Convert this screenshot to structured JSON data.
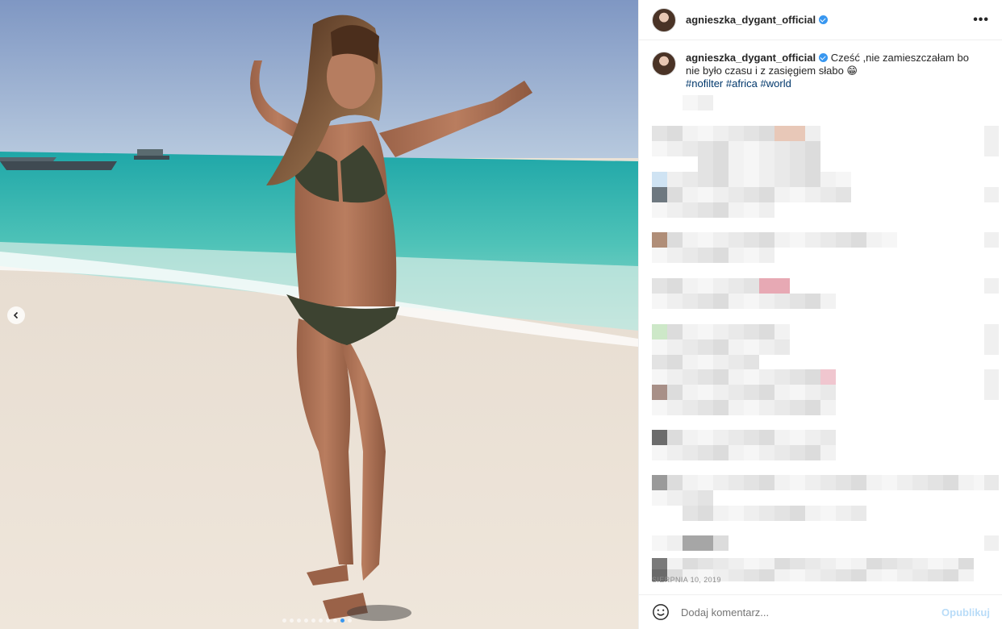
{
  "post": {
    "username": "agnieszka_dygant_official",
    "caption_text": "Cześć ,nie zamieszczałam bo nie było czasu i z zasięgiem słabo 😁",
    "hashtags": [
      "#nofilter",
      "#africa",
      "#world"
    ],
    "date": "SIERPNIA 10, 2019"
  },
  "header": {
    "more_label": "•••"
  },
  "comment_box": {
    "placeholder": "Dodaj komentarz...",
    "publish_label": "Opublikuj"
  },
  "colors": {
    "accent": "#3897f0",
    "text": "#262626",
    "muted": "#8e8e8e",
    "hashtag": "#00376b",
    "publish_disabled": "#b9dcf8"
  },
  "icons": [
    "verified-icon",
    "more-options-icon",
    "chevron-left-icon",
    "smile-icon"
  ]
}
